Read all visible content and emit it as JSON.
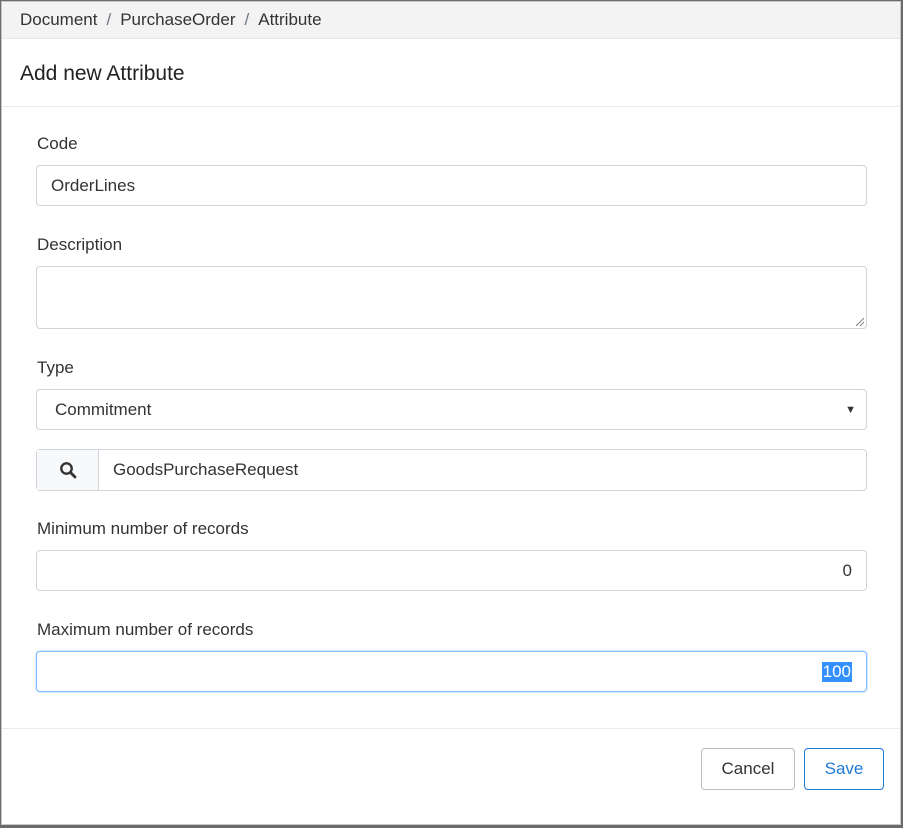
{
  "breadcrumb": {
    "items": [
      "Document",
      "PurchaseOrder",
      "Attribute"
    ],
    "separator": "/"
  },
  "modal": {
    "title": "Add new Attribute"
  },
  "form": {
    "code": {
      "label": "Code",
      "value": "OrderLines"
    },
    "description": {
      "label": "Description",
      "value": ""
    },
    "type": {
      "label": "Type",
      "value": "Commitment"
    },
    "lookup": {
      "icon": "search-icon",
      "value": "GoodsPurchaseRequest"
    },
    "min_records": {
      "label": "Minimum number of records",
      "value": "0"
    },
    "max_records": {
      "label": "Maximum number of records",
      "value": "100"
    }
  },
  "footer": {
    "cancel_label": "Cancel",
    "save_label": "Save"
  },
  "colors": {
    "save_accent": "#1f7ad6",
    "focus_border": "#80bdff",
    "selection": "#3390ff"
  }
}
